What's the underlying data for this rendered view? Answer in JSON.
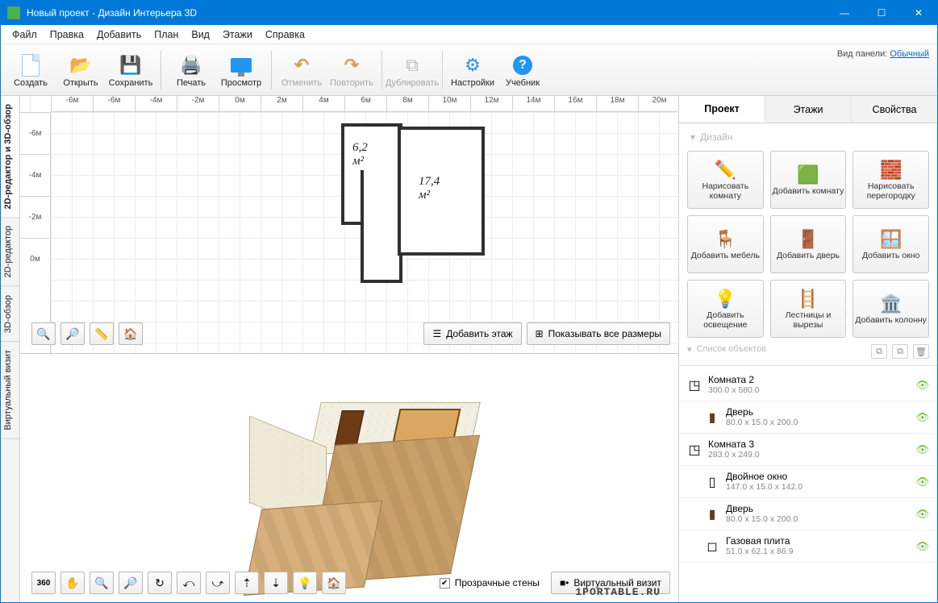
{
  "window": {
    "title": "Новый проект - Дизайн Интерьера 3D"
  },
  "menu": [
    "Файл",
    "Правка",
    "Добавить",
    "План",
    "Вид",
    "Этажи",
    "Справка"
  ],
  "toolbar": {
    "groups": [
      [
        "Создать",
        "Открыть",
        "Сохранить"
      ],
      [
        "Печать",
        "Просмотр"
      ],
      [
        "Отменить",
        "Повторить"
      ],
      [
        "Дублировать"
      ],
      [
        "Настройки",
        "Учебник"
      ]
    ],
    "panel_label": "Вид панели:",
    "panel_value": "Обычный"
  },
  "side_tabs": [
    "2D-редактор и 3D-обзор",
    "2D-редактор",
    "3D-обзор",
    "Виртуальный визит"
  ],
  "ruler_h": [
    "-6м",
    "-6м",
    "-4м",
    "-2м",
    "0м",
    "2м",
    "4м",
    "6м",
    "8м",
    "10м",
    "12м",
    "14м",
    "16м",
    "18м",
    "20м"
  ],
  "ruler_v": [
    "-6м",
    "-4м",
    "-2м",
    "0м"
  ],
  "rooms": {
    "a": "6,2 м²",
    "b": "17,4 м²"
  },
  "view2d": {
    "add_floor": "Добавить этаж",
    "show_dims": "Показывать все размеры"
  },
  "view3d": {
    "transparent": "Прозрачные стены",
    "visit": "Виртуальный визит"
  },
  "inspector": {
    "tabs": [
      "Проект",
      "Этажи",
      "Свойства"
    ],
    "section1": "Дизайн",
    "section2": "Список объектов",
    "tools": [
      "Нарисовать комнату",
      "Добавить комнату",
      "Нарисовать перегородку",
      "Добавить мебель",
      "Добавить дверь",
      "Добавить окно",
      "Добавить освещение",
      "Лестницы и вырезы",
      "Добавить колонну"
    ],
    "tree": [
      {
        "icon": "◳",
        "name": "Комната 2",
        "dim": "300.0 x 580.0",
        "indent": false
      },
      {
        "icon": "▮",
        "name": "Дверь",
        "dim": "80.0 x 15.0 x 200.0",
        "indent": true,
        "brown": true
      },
      {
        "icon": "◳",
        "name": "Комната 3",
        "dim": "283.0 x 249.0",
        "indent": false
      },
      {
        "icon": "▯",
        "name": "Двойное окно",
        "dim": "147.0 x 15.0 x 142.0",
        "indent": true
      },
      {
        "icon": "▮",
        "name": "Дверь",
        "dim": "80.0 x 15.0 x 200.0",
        "indent": true,
        "brown": true
      },
      {
        "icon": "◻",
        "name": "Газовая плита",
        "dim": "51.0 x 62.1 x 86.9",
        "indent": true
      }
    ]
  },
  "watermark": "1PORTABLE.RU"
}
